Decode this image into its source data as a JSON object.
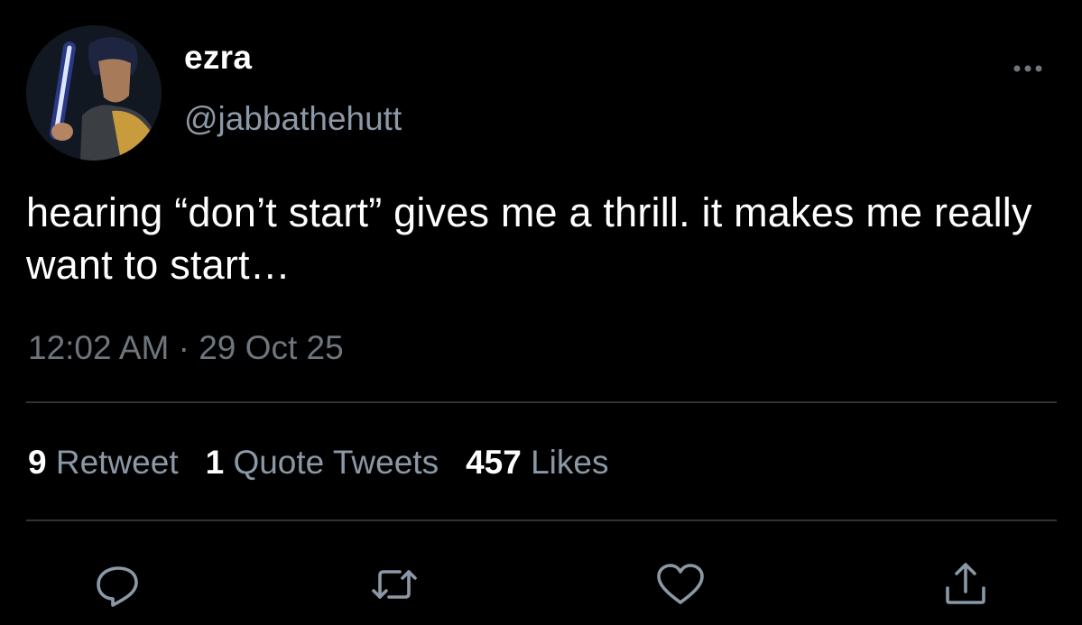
{
  "author": {
    "display_name": "ezra",
    "handle": "@jabbathehutt"
  },
  "tweet": {
    "text": "hearing “don’t start” gives me a thrill. it makes me really want to start…",
    "time": "12:02 AM",
    "separator": "·",
    "date": "29 Oct 25"
  },
  "stats": {
    "retweets": {
      "count": "9",
      "label": "Retweet"
    },
    "quotes": {
      "count": "1",
      "label": "Quote Tweets"
    },
    "likes": {
      "count": "457",
      "label": "Likes"
    }
  },
  "actions": [
    "reply-icon",
    "retweet-icon",
    "like-icon",
    "share-icon"
  ],
  "colors": {
    "background": "#000000",
    "primary_text": "#ffffff",
    "secondary_text": "#8b98a5",
    "divider": "#2f3336"
  }
}
